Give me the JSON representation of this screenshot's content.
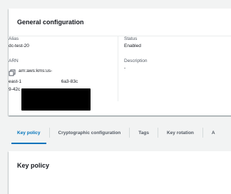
{
  "general": {
    "title": "General configuration",
    "alias_label": "Alias",
    "alias_value": "dc-test-20",
    "status_label": "Status",
    "status_value": "Enabled",
    "arn_label": "ARN",
    "arn_line1": "arn:aws:kms:us-",
    "arn_line2_start": "east-1",
    "arn_line2_end": "6a3-83c",
    "arn_line3": "9-42c",
    "description_label": "Description",
    "description_value": "-"
  },
  "tabs": [
    {
      "label": "Key policy"
    },
    {
      "label": "Cryptographic configuration"
    },
    {
      "label": "Tags"
    },
    {
      "label": "Key rotation"
    },
    {
      "label": "A"
    }
  ],
  "key_policy": {
    "title": "Key policy"
  },
  "colors": {
    "accent": "#0073bb",
    "redaction": "#000000"
  }
}
